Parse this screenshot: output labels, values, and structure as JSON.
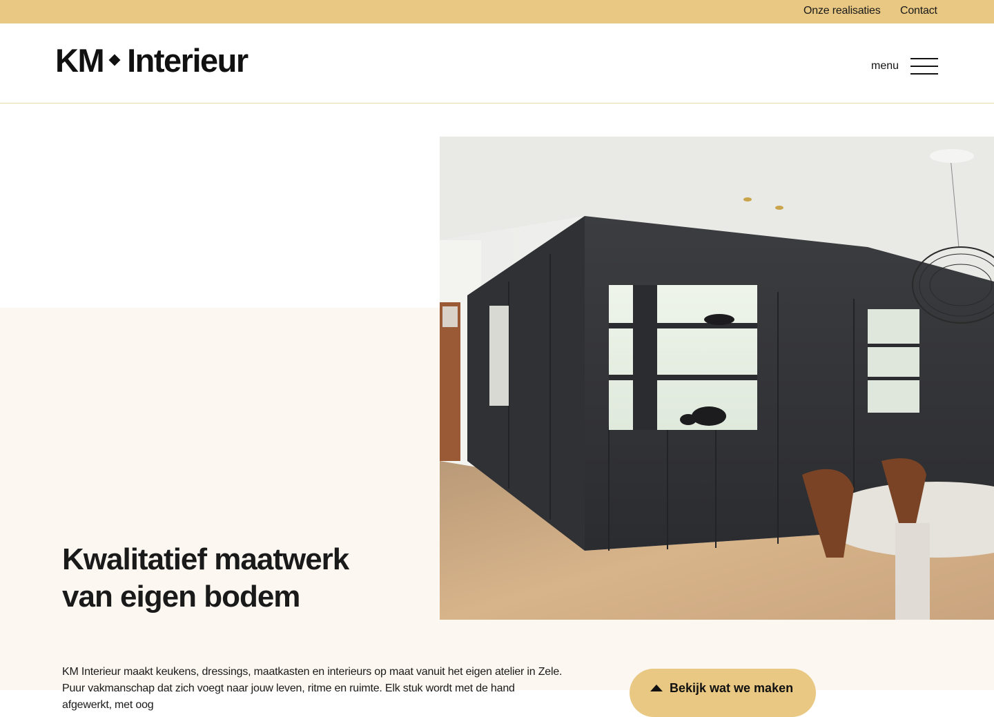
{
  "topbar": {
    "links": [
      "Onze realisaties",
      "Contact"
    ]
  },
  "header": {
    "logo_left": "KM",
    "logo_right": "Interieur",
    "menu_label": "menu"
  },
  "hero": {
    "headline_line1": "Kwalitatief maatwerk",
    "headline_line2": "van eigen bodem",
    "intro": "KM Interieur maakt keukens, dressings, maatkasten en interieurs op maat vanuit het eigen atelier in Zele. Puur vakmanschap dat zich voegt naar jouw leven, ritme en ruimte. Elk stuk wordt met de hand afgewerkt, met oog",
    "cta_label": "Bekijk wat we maken"
  },
  "colors": {
    "accent": "#e8c882",
    "cream": "#fcf7f0",
    "text": "#1a1a1a"
  }
}
